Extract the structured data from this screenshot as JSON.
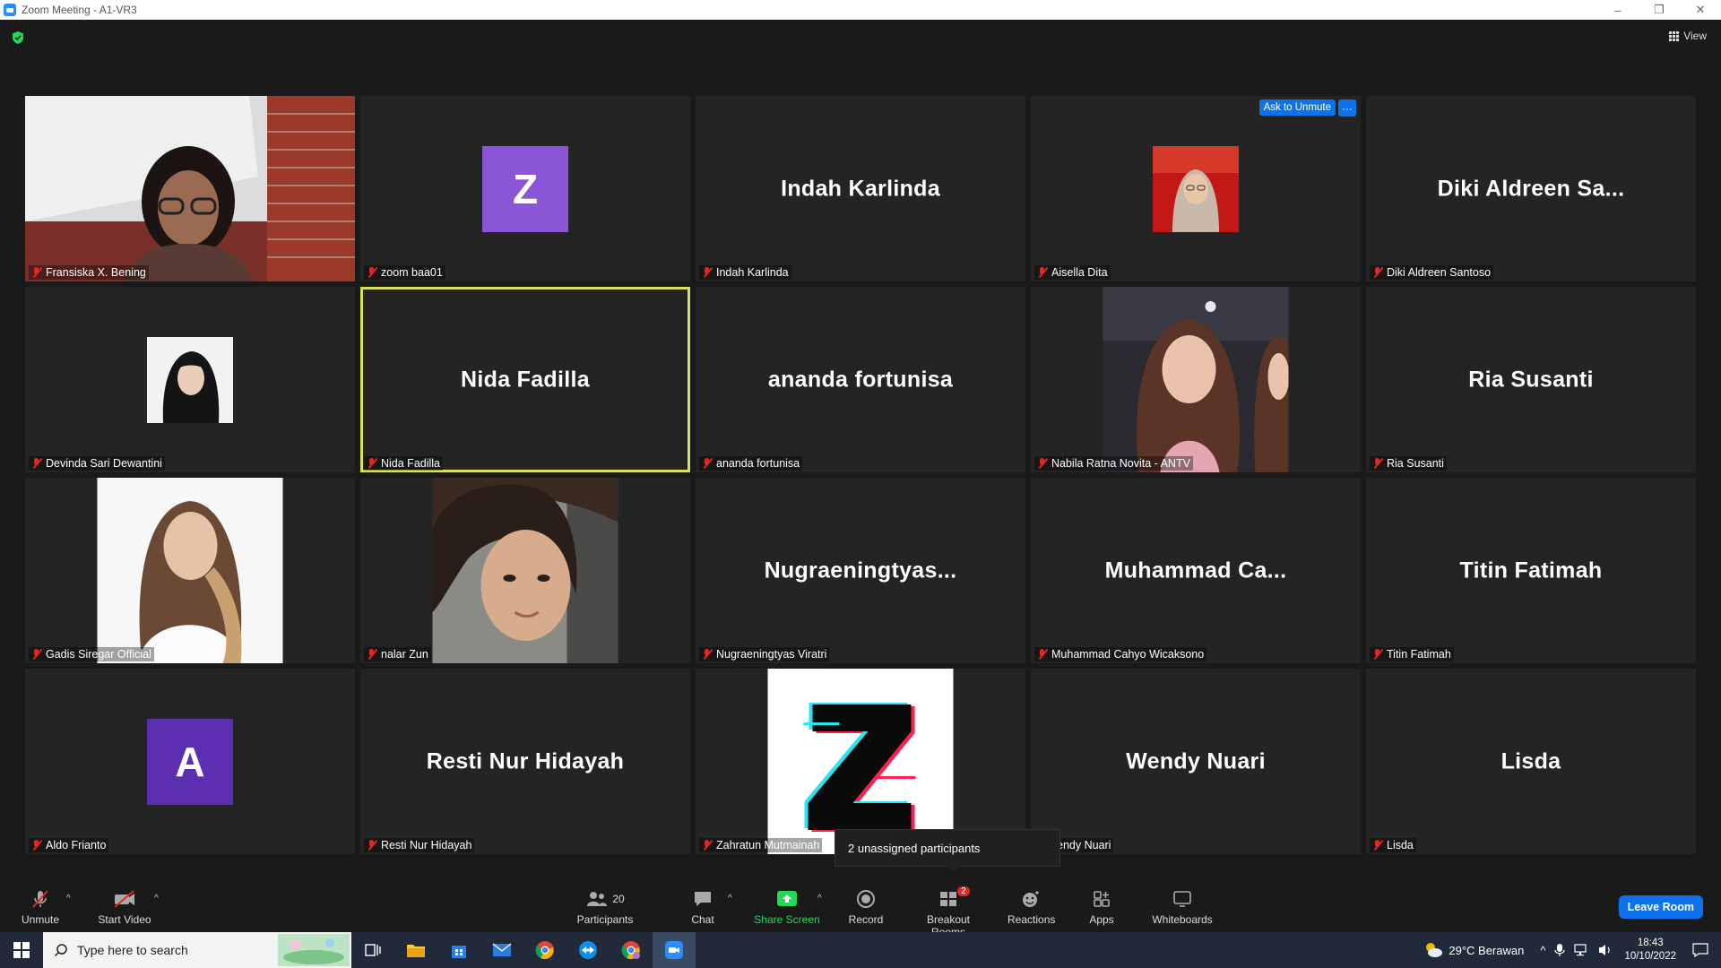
{
  "window": {
    "title": "Zoom Meeting - A1-VR3"
  },
  "topbar": {
    "view_label": "View"
  },
  "tiles": [
    {
      "big_name": "",
      "label": "Fransiska X. Bening",
      "kind": "photo-wide"
    },
    {
      "big_name": "",
      "label": "zoom baa01",
      "kind": "letter",
      "letter": "Z",
      "color": "#8a56d6"
    },
    {
      "big_name": "Indah Karlinda",
      "label": "Indah Karlinda",
      "kind": "name"
    },
    {
      "big_name": "",
      "label": "Aisella Dita",
      "kind": "small-photo",
      "ask_to_unmute": "Ask to Unmute",
      "more": "···"
    },
    {
      "big_name": "Diki  Aldreen Sa...",
      "label": "Diki Aldreen Santoso",
      "kind": "name"
    },
    {
      "big_name": "",
      "label": "Devinda Sari Dewantini",
      "kind": "small-photo"
    },
    {
      "big_name": "Nida Fadilla",
      "label": "Nida Fadilla",
      "kind": "name",
      "active": true
    },
    {
      "big_name": "ananda fortunisa",
      "label": "ananda fortunisa",
      "kind": "name"
    },
    {
      "big_name": "",
      "label": "Nabila Ratna Novita - ANTV",
      "kind": "photo"
    },
    {
      "big_name": "Ria Susanti",
      "label": "Ria Susanti",
      "kind": "name"
    },
    {
      "big_name": "",
      "label": "Gadis Siregar Official",
      "kind": "photo"
    },
    {
      "big_name": "",
      "label": "nalar Zun",
      "kind": "photo"
    },
    {
      "big_name": "Nugraeningtyas...",
      "label": "Nugraeningtyas Viratri",
      "kind": "name"
    },
    {
      "big_name": "Muhammad  Ca...",
      "label": "Muhammad Cahyo Wicaksono",
      "kind": "name"
    },
    {
      "big_name": "Titin Fatimah",
      "label": "Titin Fatimah",
      "kind": "name"
    },
    {
      "big_name": "",
      "label": "Aldo Frianto",
      "kind": "letter",
      "letter": "A",
      "color": "#5b2fb0"
    },
    {
      "big_name": "Resti Nur Hidayah",
      "label": "Resti Nur Hidayah",
      "kind": "name"
    },
    {
      "big_name": "",
      "label": "Zahratun Mutmainah",
      "kind": "logo-z"
    },
    {
      "big_name": "Wendy Nuari",
      "label": "endy Nuari",
      "kind": "name"
    },
    {
      "big_name": "Lisda",
      "label": "Lisda",
      "kind": "name"
    }
  ],
  "tooltip": {
    "text": "2 unassigned participants"
  },
  "toolbar": {
    "unmute": "Unmute",
    "start_video": "Start Video",
    "participants": "Participants",
    "participants_count": "20",
    "chat": "Chat",
    "share_screen": "Share Screen",
    "record": "Record",
    "breakout_rooms": "Breakout Rooms",
    "breakout_badge": "2",
    "reactions": "Reactions",
    "apps": "Apps",
    "whiteboards": "Whiteboards",
    "leave_room": "Leave Room"
  },
  "taskbar": {
    "search_placeholder": "Type here to search",
    "weather": "29°C  Berawan",
    "time": "18:43",
    "date": "10/10/2022"
  },
  "colors": {
    "accent": "#0e72ed",
    "active_border": "#d6e35a",
    "share_green": "#23d959",
    "muted_red": "#e02828"
  }
}
